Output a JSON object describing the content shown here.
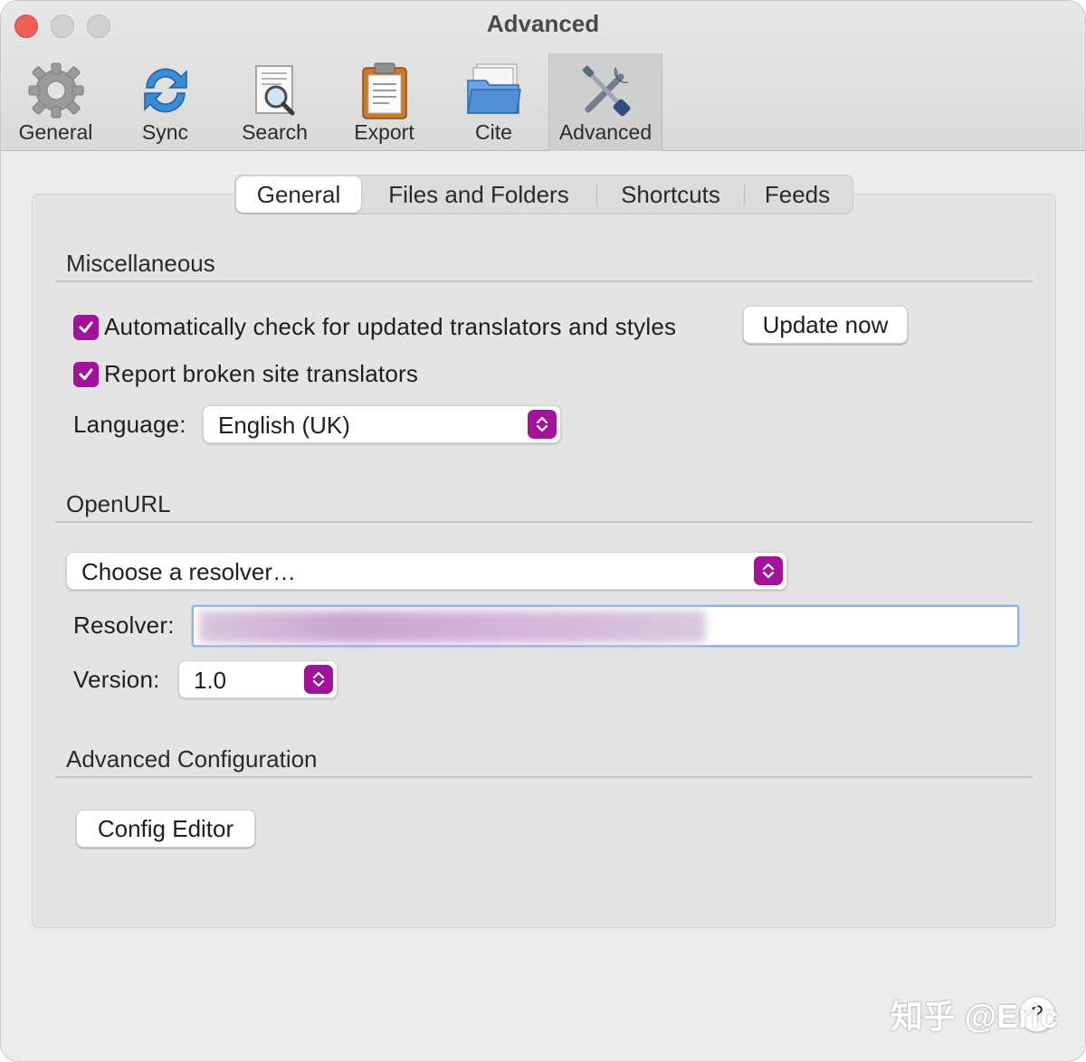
{
  "window": {
    "title": "Advanced"
  },
  "toolbar": {
    "items": [
      {
        "label": "General",
        "icon": "gear-icon"
      },
      {
        "label": "Sync",
        "icon": "sync-icon"
      },
      {
        "label": "Search",
        "icon": "search-icon"
      },
      {
        "label": "Export",
        "icon": "clipboard-icon"
      },
      {
        "label": "Cite",
        "icon": "folder-icon"
      },
      {
        "label": "Advanced",
        "icon": "tools-icon",
        "active": true
      }
    ]
  },
  "tabs": [
    {
      "label": "General",
      "active": true
    },
    {
      "label": "Files and Folders"
    },
    {
      "label": "Shortcuts"
    },
    {
      "label": "Feeds"
    }
  ],
  "misc": {
    "title": "Miscellaneous",
    "auto_check_label": "Automatically check for updated translators and styles",
    "auto_check_checked": true,
    "update_button": "Update now",
    "report_label": "Report broken site translators",
    "report_checked": true,
    "language_label": "Language:",
    "language_value": "English (UK)"
  },
  "openurl": {
    "title": "OpenURL",
    "resolver_select": "Choose a resolver…",
    "resolver_label": "Resolver:",
    "version_label": "Version:",
    "version_value": "1.0"
  },
  "advanced_config": {
    "title": "Advanced Configuration",
    "config_editor_button": "Config Editor"
  },
  "help": {
    "label": "?"
  },
  "watermark": {
    "text": "知乎 @Eric"
  },
  "colors": {
    "accent": "#a2139a",
    "focus_ring": "#8fb4e6",
    "close": "#ee5f57"
  }
}
